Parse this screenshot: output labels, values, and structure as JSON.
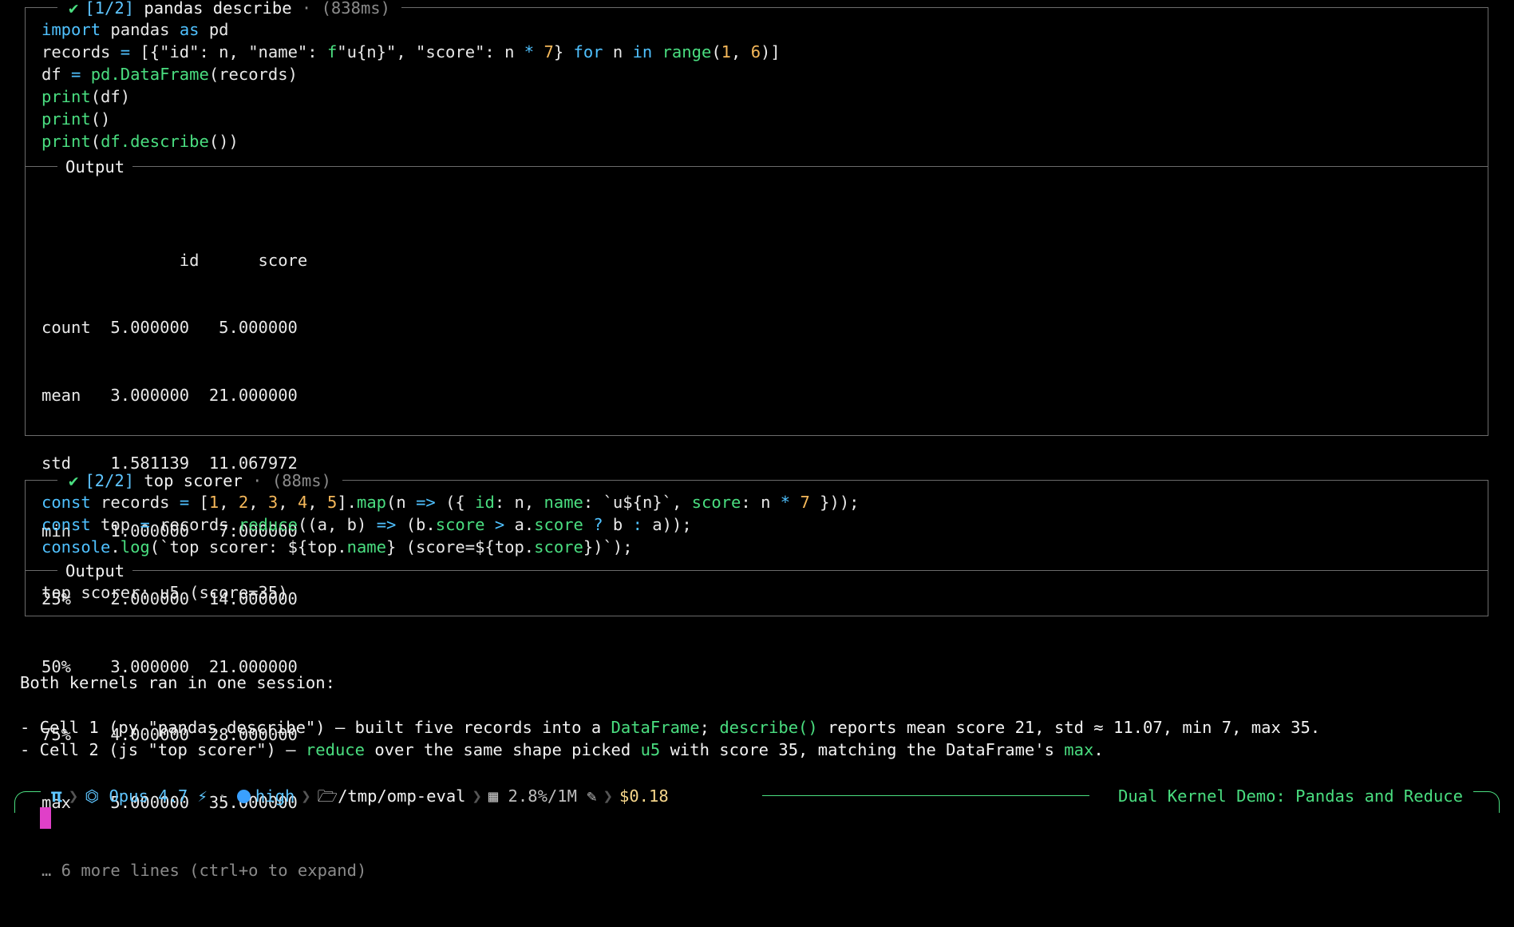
{
  "cell1": {
    "check": "✔",
    "index": "[1/2]",
    "name": "pandas describe",
    "sep": " · ",
    "time": "(838ms)",
    "output_label": "Output",
    "table_header": "              id      score",
    "table_rows": [
      "count  5.000000   5.000000",
      "mean   3.000000  21.000000",
      "std    1.581139  11.067972",
      "min    1.000000   7.000000",
      "25%    2.000000  14.000000",
      "50%    3.000000  21.000000",
      "75%    4.000000  28.000000",
      "max    5.000000  35.000000"
    ],
    "more": "… 6 more lines (ctrl+o to expand)"
  },
  "cell2": {
    "check": "✔",
    "index": "[2/2]",
    "name": "top scorer",
    "sep": " · ",
    "time": "(88ms)",
    "output_label": "Output",
    "output": "top scorer: u5 (score=35)"
  },
  "summary": {
    "intro": "Both kernels ran in one session:",
    "b1_a": "- Cell 1 (py \"pandas describe\") — built five records into a ",
    "b1_hl1": "DataFrame",
    "b1_b": "; ",
    "b1_hl2": "describe()",
    "b1_c": " reports mean score 21, std ≈ 11.07, min 7, max 35.",
    "b2_a": "- Cell 2 (js \"top scorer\") — ",
    "b2_hl1": "reduce",
    "b2_b": " over the same shape picked ",
    "b2_hl2": "u5",
    "b2_c": " with score 35, matching the DataFrame's ",
    "b2_hl3": "max",
    "b2_d": "."
  },
  "status": {
    "pi": "π",
    "model": "Opus 4.7",
    "effort": "high",
    "path": "/tmp/omp-eval",
    "context": "2.8%/1M",
    "cost": "$0.18",
    "session_title": "Dual Kernel Demo: Pandas and Reduce"
  },
  "colors": {
    "accent_green": "#4ade80",
    "accent_blue": "#4fc1ff",
    "number": "#f5b85a",
    "cursor": "#e040c8"
  }
}
